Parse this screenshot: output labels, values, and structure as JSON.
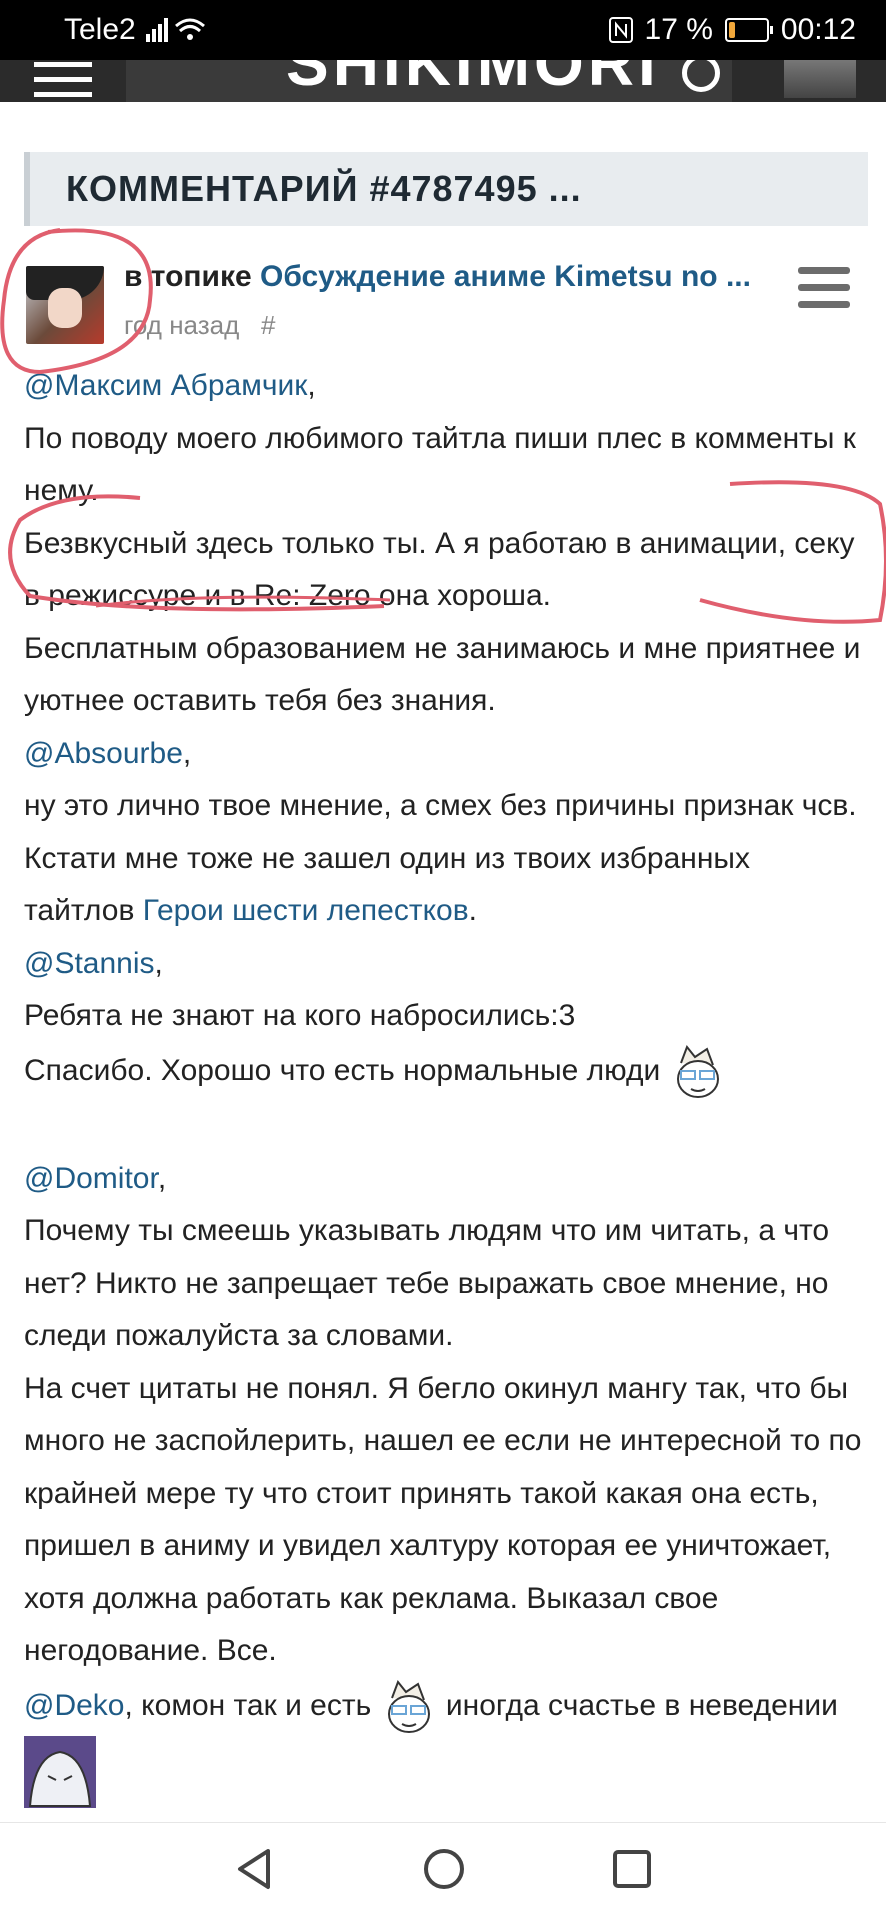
{
  "status": {
    "carrier": "Tele2",
    "battery": "17 %",
    "battery_level": 0.17,
    "time": "00:12",
    "accent": "#f2a83b"
  },
  "appbar": {
    "brand": "SHIKIMORI"
  },
  "header": {
    "title": "КОММЕНТАРИЙ #4787495 ..."
  },
  "post": {
    "prefix": "в топике",
    "topic": "Обсуждение аниме Kimetsu no ...",
    "time": "год назад",
    "hash": "#"
  },
  "body": {
    "m1": "@Максим Абрамчик",
    "p1": "По поводу моего любимого тайтла пиши плес в комменты к нему.",
    "p2": "Безвкусный здесь только ты. А я работаю в анимации, секу в режиссуре и в Re: Zero она хороша.",
    "p3": "Бесплатным образованием не занимаюсь и мне приятнее и уютнее оставить тебя без знания.",
    "m2": "@Absourbe",
    "p4": "ну это лично твое мнение, а смех без причины признак чсв. Кстати мне тоже не зашел один из твоих избранных тайтлов",
    "link1": "Герои шести лепестков",
    "m3": "@Stannis",
    "p5": "Ребята не знают на кого набросились:3",
    "p6": "Спасибо. Хорошо что есть нормальные люди",
    "m4": "@Domitor",
    "p7": "Почему ты смеешь указывать людям что им читать, а что нет? Никто не запрещает тебе выражать свое мнение, но следи пожалуйста за словами.",
    "p8": "На счет цитаты не понял. Я бегло окинул мангу так, что бы много не заспойлерить, нашел ее если не интересной то по крайней мере ту что стоит принять такой какая она есть, пришел в аниму и увидел халтуру которая ее уничтожает, хотя должна работать как реклама. Выказал свое негодование. Все.",
    "m5": "@Deko",
    "p9": ", комон так и есть",
    "p10": "иногда счастье в неведении"
  }
}
